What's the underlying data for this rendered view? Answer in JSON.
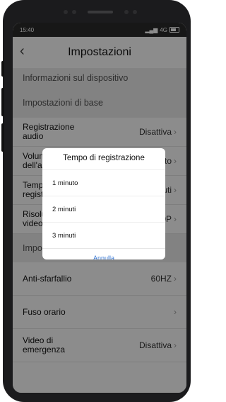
{
  "status_bar": {
    "time": "15:40",
    "network": "4G"
  },
  "header": {
    "title": "Impostazioni"
  },
  "sections": {
    "device_info": "Informazioni sul dispositivo",
    "basic": "Impostazioni di base",
    "advanced": "Impostazioni avanzate"
  },
  "rows": [
    {
      "label": "Registrazione audio",
      "value": "Disattiva"
    },
    {
      "label": "Volume dell'altoparlante",
      "value": "Alto"
    },
    {
      "label": "Tempo di registrazione",
      "value": "1 minuti"
    },
    {
      "label": "Risoluzione video",
      "value": "1080P"
    },
    {
      "label": "Anti-sfarfallio",
      "value": "60HZ"
    },
    {
      "label": "Fuso orario",
      "value": ""
    },
    {
      "label": "Video di emergenza",
      "value": "Disattiva"
    }
  ],
  "dialog": {
    "title": "Tempo di registrazione",
    "options": [
      "1 minuto",
      "2 minuti",
      "3 minuti"
    ],
    "cancel": "Annulla"
  }
}
